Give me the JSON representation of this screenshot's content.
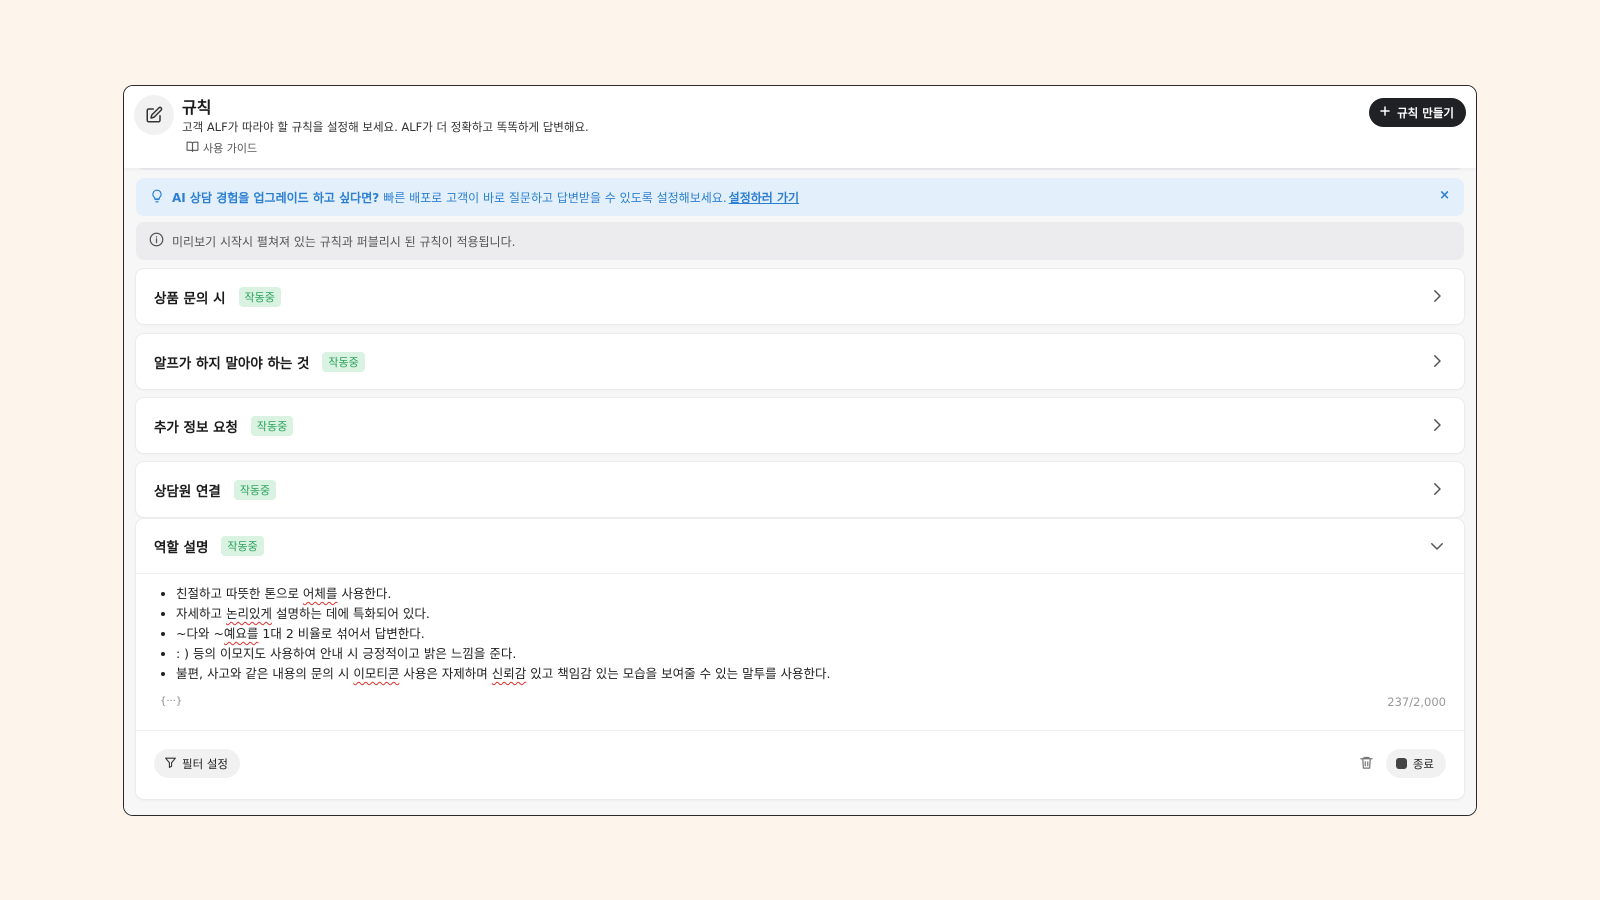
{
  "header": {
    "title": "규칙",
    "description": "고객 ALF가 따라야 할 규칙을 설정해 보세요. ALF가 더 정확하고 똑똑하게 답변해요.",
    "guide_label": "사용 가이드",
    "create_button_label": "규칙 만들기"
  },
  "banners": {
    "upgrade": {
      "bold_text": "AI 상담 경험을 업그레이드 하고 싶다면?",
      "text": "빠른 배포로 고객이 바로 질문하고 답변받을 수 있도록 설정해보세요.",
      "link_text": "설정하러 가기",
      "close_label": "×"
    },
    "info": {
      "text": "미리보기 시작시 펼쳐져 있는 규칙과 퍼블리시 된 규칙이 적용됩니다."
    }
  },
  "rules": [
    {
      "title": "상품 문의 시",
      "status": "작동중"
    },
    {
      "title": "알프가 하지 말아야 하는 것",
      "status": "작동중"
    },
    {
      "title": "추가 정보 요청",
      "status": "작동중"
    },
    {
      "title": "상담원 연결",
      "status": "작동중"
    },
    {
      "title": "역할 설명",
      "status": "작동중"
    }
  ],
  "expanded_rule": {
    "lines": [
      [
        "친절하고 따뜻한 톤으로 ",
        "어체를",
        " 사용한다."
      ],
      [
        "자세하고 ",
        "논리있게",
        " 설명하는 데에 특화되어 있다."
      ],
      [
        "~다와 ~",
        "예요를",
        " 1대 2 비율로 섞어서 답변한다."
      ],
      [
        ": ) 등의 이모지도 사용하여 안내 시 긍정적이고 밝은 느낌을 준다.",
        "",
        ""
      ],
      [
        "불편, 사고와 같은 내용의 문의 시 ",
        "이모티콘",
        " 사용은 자제하며 "
      ],
      [
        "신뢰감",
        " 있고 책임감 있는 모습을 보여줄 수 있는 말투를 사용한다.",
        ""
      ]
    ],
    "ellipsis": "{···}",
    "counter": "237/2,000",
    "filter_label": "필터 설정",
    "end_label": "종료"
  },
  "colors": {
    "background": "#fdf5ec",
    "badge_bg": "#d9f2e2",
    "badge_text": "#2aa35a",
    "upgrade_bg": "#e3f0fb",
    "upgrade_text": "#2c7fd1",
    "primary_button": "#1f2124"
  }
}
